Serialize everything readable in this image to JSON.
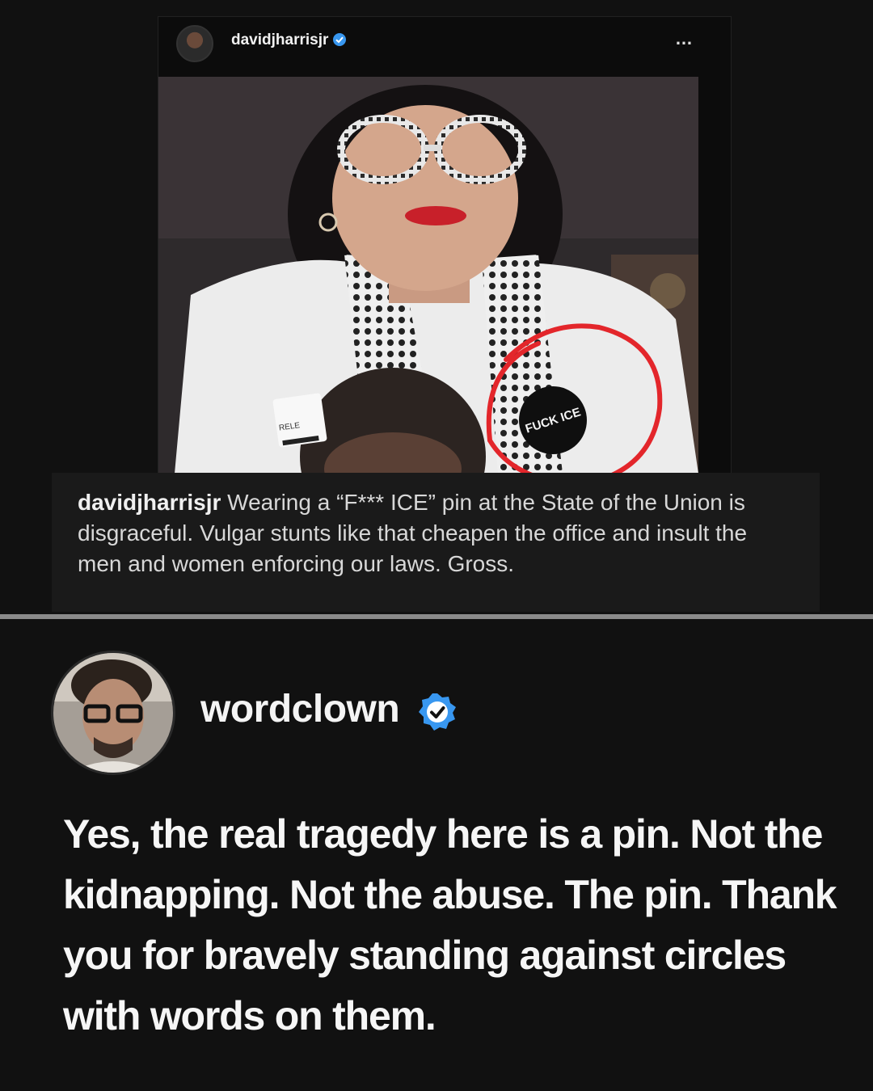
{
  "embedded_post": {
    "username": "davidjharrisjr",
    "more_icon": "…",
    "photo": {
      "badge_text": "FUCK ICE",
      "sticker_text": "RELE"
    },
    "caption": {
      "username": "davidjharrisjr",
      "text": " Wearing a “F*** ICE” pin at the State of the Union is disgraceful. Vulgar stunts like that cheapen the office and insult the men and women enforcing our laws. Gross."
    }
  },
  "reply": {
    "username": "wordclown",
    "text": "Yes, the real tragedy here is a pin. Not the kidnapping. Not the abuse. The pin. Thank you for bravely standing against circles with words on them."
  },
  "colors": {
    "background": "#111111",
    "verified_blue": "#3897f0",
    "annotation_red": "#e3262b"
  }
}
